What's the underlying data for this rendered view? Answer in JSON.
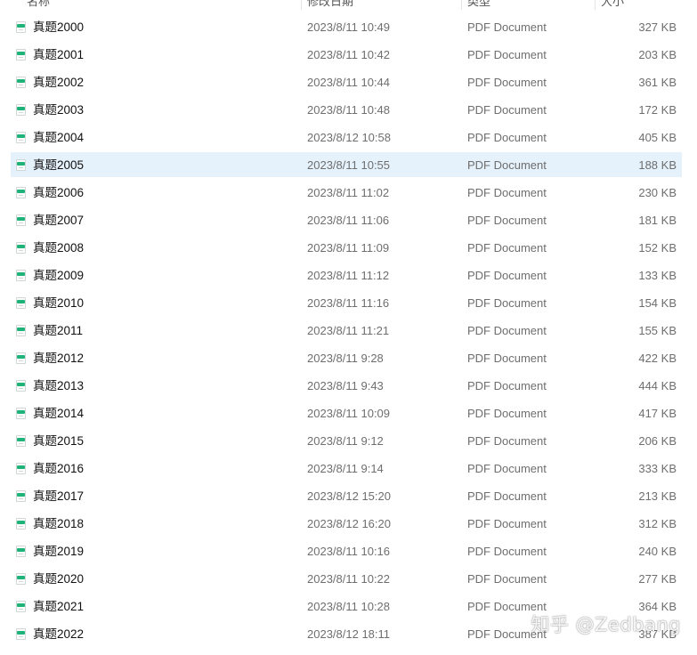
{
  "columns": {
    "name": "名称",
    "date": "修改日期",
    "type": "类型",
    "size": "大小"
  },
  "selected_index": 5,
  "files": [
    {
      "name": "真题2000",
      "date": "2023/8/11 10:49",
      "type": "PDF Document",
      "size": "327 KB"
    },
    {
      "name": "真题2001",
      "date": "2023/8/11 10:42",
      "type": "PDF Document",
      "size": "203 KB"
    },
    {
      "name": "真题2002",
      "date": "2023/8/11 10:44",
      "type": "PDF Document",
      "size": "361 KB"
    },
    {
      "name": "真题2003",
      "date": "2023/8/11 10:48",
      "type": "PDF Document",
      "size": "172 KB"
    },
    {
      "name": "真题2004",
      "date": "2023/8/12 10:58",
      "type": "PDF Document",
      "size": "405 KB"
    },
    {
      "name": "真题2005",
      "date": "2023/8/11 10:55",
      "type": "PDF Document",
      "size": "188 KB"
    },
    {
      "name": "真题2006",
      "date": "2023/8/11 11:02",
      "type": "PDF Document",
      "size": "230 KB"
    },
    {
      "name": "真题2007",
      "date": "2023/8/11 11:06",
      "type": "PDF Document",
      "size": "181 KB"
    },
    {
      "name": "真题2008",
      "date": "2023/8/11 11:09",
      "type": "PDF Document",
      "size": "152 KB"
    },
    {
      "name": "真题2009",
      "date": "2023/8/11 11:12",
      "type": "PDF Document",
      "size": "133 KB"
    },
    {
      "name": "真题2010",
      "date": "2023/8/11 11:16",
      "type": "PDF Document",
      "size": "154 KB"
    },
    {
      "name": "真题2011",
      "date": "2023/8/11 11:21",
      "type": "PDF Document",
      "size": "155 KB"
    },
    {
      "name": "真题2012",
      "date": "2023/8/11 9:28",
      "type": "PDF Document",
      "size": "422 KB"
    },
    {
      "name": "真题2013",
      "date": "2023/8/11 9:43",
      "type": "PDF Document",
      "size": "444 KB"
    },
    {
      "name": "真题2014",
      "date": "2023/8/11 10:09",
      "type": "PDF Document",
      "size": "417 KB"
    },
    {
      "name": "真题2015",
      "date": "2023/8/11 9:12",
      "type": "PDF Document",
      "size": "206 KB"
    },
    {
      "name": "真题2016",
      "date": "2023/8/11 9:14",
      "type": "PDF Document",
      "size": "333 KB"
    },
    {
      "name": "真题2017",
      "date": "2023/8/12 15:20",
      "type": "PDF Document",
      "size": "213 KB"
    },
    {
      "name": "真题2018",
      "date": "2023/8/12 16:20",
      "type": "PDF Document",
      "size": "312 KB"
    },
    {
      "name": "真题2019",
      "date": "2023/8/11 10:16",
      "type": "PDF Document",
      "size": "240 KB"
    },
    {
      "name": "真题2020",
      "date": "2023/8/11 10:22",
      "type": "PDF Document",
      "size": "277 KB"
    },
    {
      "name": "真题2021",
      "date": "2023/8/11 10:28",
      "type": "PDF Document",
      "size": "364 KB"
    },
    {
      "name": "真题2022",
      "date": "2023/8/12 18:11",
      "type": "PDF Document",
      "size": "387 KB"
    }
  ],
  "icon": "pdf-file-icon",
  "colors": {
    "selection": "#e5f1fb",
    "icon_accent": "#1fb37a"
  },
  "watermark": "知乎 @Zedbang"
}
